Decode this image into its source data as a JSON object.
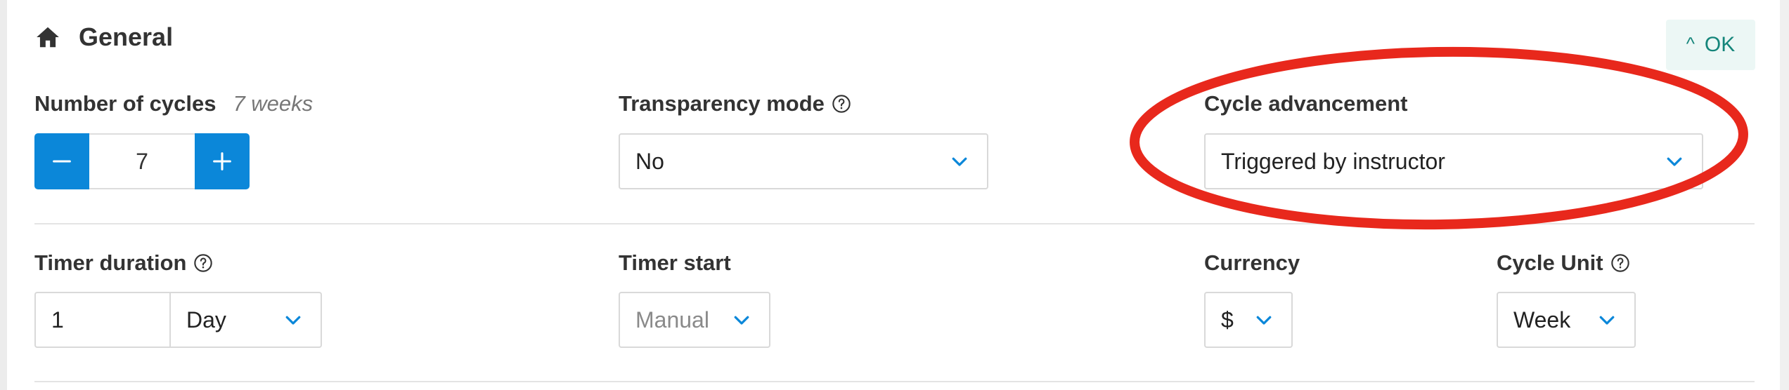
{
  "section": {
    "title": "General",
    "icon": "home-icon",
    "collapse_button": "OK"
  },
  "number_of_cycles": {
    "label": "Number of cycles",
    "hint": "7 weeks",
    "value": "7"
  },
  "transparency_mode": {
    "label": "Transparency mode",
    "value": "No"
  },
  "cycle_advancement": {
    "label": "Cycle advancement",
    "value": "Triggered by instructor"
  },
  "timer_duration": {
    "label": "Timer duration",
    "amount": "1",
    "unit": "Day"
  },
  "timer_start": {
    "label": "Timer start",
    "value": "Manual"
  },
  "currency": {
    "label": "Currency",
    "value": "$"
  },
  "cycle_unit": {
    "label": "Cycle Unit",
    "value": "Week"
  },
  "colors": {
    "accent_blue": "#0b87d9",
    "ok_text": "#14857a",
    "annotation_red": "#e8281c"
  }
}
